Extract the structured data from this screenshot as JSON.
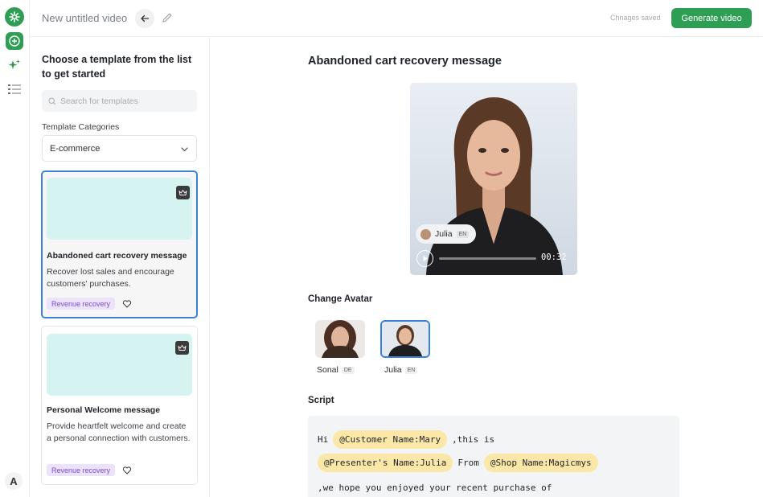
{
  "topbar": {
    "doc_title": "New untitled video",
    "saved_status": "Chnages saved",
    "generate_label": "Generate video"
  },
  "rail": {
    "user_initial": "A"
  },
  "sidebar": {
    "heading": "Choose a template from the list to get started",
    "search_placeholder": "Search for templates",
    "category_label": "Template Categories",
    "category_value": "E-commerce",
    "templates": [
      {
        "title": "Abandoned cart recovery message",
        "description": "Recover lost sales and encourage customers' purchases.",
        "tag": "Revenue recovery"
      },
      {
        "title": "Personal Welcome message",
        "description": "Provide heartfelt welcome and create a personal connection with customers.",
        "tag": "Revenue recovery"
      }
    ]
  },
  "main": {
    "title": "Abandoned cart recovery message",
    "video": {
      "presenter": "Julia",
      "language": "EN",
      "time": "00:32",
      "progress": 0
    },
    "change_avatar_label": "Change Avatar",
    "avatars": [
      {
        "name": "Sonal",
        "language": "DE"
      },
      {
        "name": "Julia",
        "language": "EN"
      }
    ],
    "script_label": "Script",
    "script": {
      "line1_prefix": "Hi",
      "customer_chip": "@Customer Name:Mary",
      "line1_suffix": ",this is",
      "presenter_chip": "@Presenter's Name:Julia",
      "from_word": "From",
      "shop_chip": "@Shop Name:Magicmys",
      "line3": ",we hope you enjoyed your recent purchase of"
    }
  },
  "colors": {
    "brand_green": "#2f9e55",
    "selection_blue": "#3b82d6",
    "template_thumb": "#d5f3f1",
    "tag_bg": "#ece2fb",
    "variable_chip": "#fbe7a8"
  }
}
